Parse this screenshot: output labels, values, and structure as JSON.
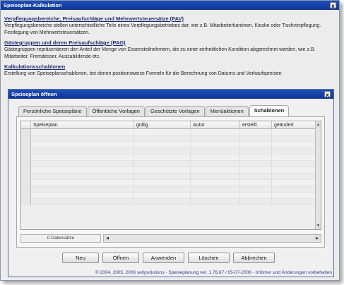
{
  "window": {
    "title": "Speiseplan-Kalkulation",
    "close_label": "x"
  },
  "background": {
    "sections": [
      {
        "heading": "Verpflegungsbereiche, Preisaufschläge und Mehrwertsteuersätze (PAV)",
        "body": "Verpflegungsbereiche stellen unterschiedliche Teile eines Verpflegungsbetriebes dar, wie z.B. Mitarbeiterkantinen, Kioske oder Tischverpflegung. Festlegung von Mehrwertsteuersätzen."
      },
      {
        "heading": "Gästegruppen und deren Preisaufschläge (PAG)",
        "body": "Gästegruppen repräsentieren den Anteil der Menge von Essensteilnehmern, die zu einer einheitlichen Kondition abgerechnet werden, wie z.B. Mitarbeiter, Fremdesser, Auszubildende etc."
      },
      {
        "heading": "Kalkulationsschablonen",
        "body": "Erstellung von Speiseplanschablonen, bei denen positionsweise Formeln für die Berechnung von Datums und Verkaufspreisen"
      }
    ]
  },
  "dialog": {
    "title": "Speiseplan öffnen",
    "close_label": "x",
    "tabs": [
      "Persönliche Speisepläne",
      "Öffentliche Vorlagen",
      "Geschützte Vorlagen",
      "Menüaktionen",
      "Schablonen"
    ],
    "active_tab": "Schablonen",
    "table": {
      "columns": [
        "Speiseplan",
        "gültig",
        "Autor",
        "erstellt",
        "geändert"
      ]
    },
    "status_text": "0 Datensätze",
    "buttons": [
      "Neu",
      "Öffnen",
      "Anwenden",
      "Löschen",
      "Abbrechen"
    ],
    "copyright": "© 2004, 2005, 2006 sellysolutions - Speiseplanung ver. 1.76.67 / 05-07-2006 - Irrtümer und Änderungen vorbehalten"
  }
}
